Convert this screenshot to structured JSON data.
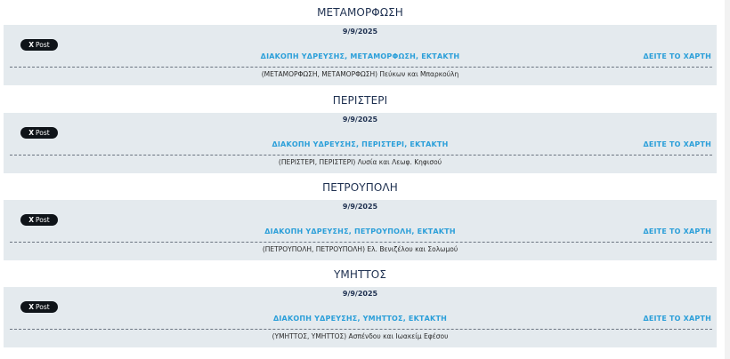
{
  "sections": [
    {
      "title": "ΜΕΤΑΜΟΡΦΩΣΗ",
      "date": "9/9/2025",
      "share_label": "Post",
      "share_icon": "X",
      "alert": "ΔΙΑΚΟΠΗ ΥΔΡΕΥΣΗΣ, ΜΕΤΑΜΟΡΦΩΣΗ, ΕΚΤΑΚΤΗ",
      "map_link": "ΔΕΙΤΕ ΤΟ ΧΑΡΤΗ",
      "streets": "(ΜΕΤΑΜΟΡΦΩΣΗ, ΜΕΤΑΜΟΡΦΩΣΗ) Πεύκων και Μπαρκούλη"
    },
    {
      "title": "ΠΕΡΙΣΤΕΡΙ",
      "date": "9/9/2025",
      "share_label": "Post",
      "share_icon": "X",
      "alert": "ΔΙΑΚΟΠΗ ΥΔΡΕΥΣΗΣ, ΠΕΡΙΣΤΕΡΙ, ΕΚΤΑΚΤΗ",
      "map_link": "ΔΕΙΤΕ ΤΟ ΧΑΡΤΗ",
      "streets": "(ΠΕΡΙΣΤΕΡΙ, ΠΕΡΙΣΤΕΡΙ) Λυσία και Λεωφ. Κηφισού"
    },
    {
      "title": "ΠΕΤΡΟΥΠΟΛΗ",
      "date": "9/9/2025",
      "share_label": "Post",
      "share_icon": "X",
      "alert": "ΔΙΑΚΟΠΗ ΥΔΡΕΥΣΗΣ, ΠΕΤΡΟΥΠΟΛΗ, ΕΚΤΑΚΤΗ",
      "map_link": "ΔΕΙΤΕ ΤΟ ΧΑΡΤΗ",
      "streets": "(ΠΕΤΡΟΥΠΟΛΗ, ΠΕΤΡΟΥΠΟΛΗ) Ελ. Βενιζέλου και Σολωμού"
    },
    {
      "title": "ΥΜΗΤΤΟΣ",
      "date": "9/9/2025",
      "share_label": "Post",
      "share_icon": "X",
      "alert": "ΔΙΑΚΟΠΗ ΥΔΡΕΥΣΗΣ, ΥΜΗΤΤΟΣ, ΕΚΤΑΚΤΗ",
      "map_link": "ΔΕΙΤΕ ΤΟ ΧΑΡΤΗ",
      "streets": "(ΥΜΗΤΤΟΣ, ΥΜΗΤΤΟΣ) Ασπένδου και Ιωακείμ Εφέσου"
    }
  ],
  "colors": {
    "title": "#1e3050",
    "card_bg": "#e4eaee",
    "link": "#2b9fd9",
    "share_button_bg": "#0f1419"
  }
}
